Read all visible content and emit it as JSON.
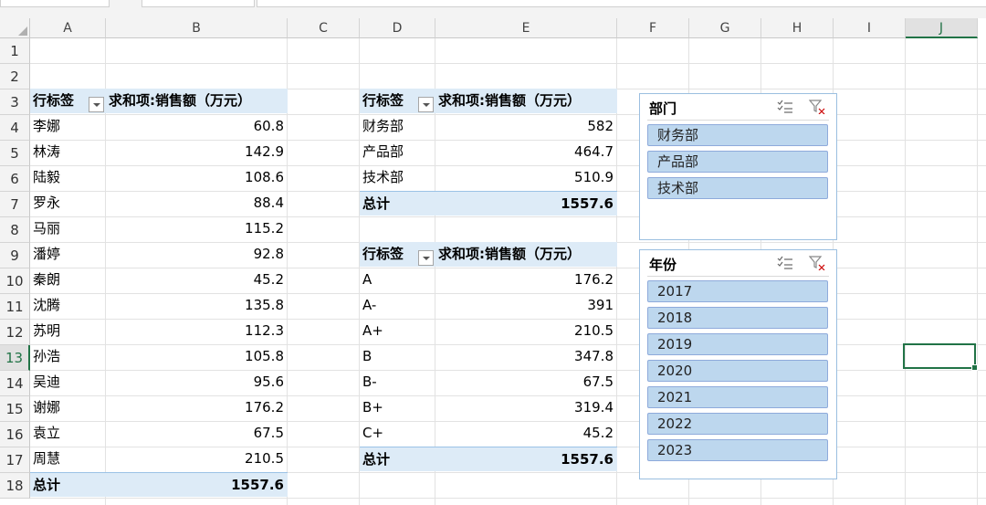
{
  "columns": [
    "A",
    "B",
    "C",
    "D",
    "E",
    "F",
    "G",
    "H",
    "I",
    "J"
  ],
  "selected_column": "J",
  "rows": [
    "1",
    "2",
    "3",
    "4",
    "5",
    "6",
    "7",
    "8",
    "9",
    "10",
    "11",
    "12",
    "13",
    "14",
    "15",
    "16",
    "17",
    "18"
  ],
  "selected_row": "13",
  "pivot1": {
    "row_label_header": "行标签",
    "value_header": "求和项:销售额（万元）",
    "rows": [
      {
        "label": "李娜",
        "value": "60.8"
      },
      {
        "label": "林涛",
        "value": "142.9"
      },
      {
        "label": "陆毅",
        "value": "108.6"
      },
      {
        "label": "罗永",
        "value": "88.4"
      },
      {
        "label": "马丽",
        "value": "115.2"
      },
      {
        "label": "潘婷",
        "value": "92.8"
      },
      {
        "label": "秦朗",
        "value": "45.2"
      },
      {
        "label": "沈腾",
        "value": "135.8"
      },
      {
        "label": "苏明",
        "value": "112.3"
      },
      {
        "label": "孙浩",
        "value": "105.8"
      },
      {
        "label": "吴迪",
        "value": "95.6"
      },
      {
        "label": "谢娜",
        "value": "176.2"
      },
      {
        "label": "袁立",
        "value": "67.5"
      },
      {
        "label": "周慧",
        "value": "210.5"
      }
    ],
    "total_label": "总计",
    "total_value": "1557.6"
  },
  "pivot2": {
    "row_label_header": "行标签",
    "value_header": "求和项:销售额（万元）",
    "rows": [
      {
        "label": "财务部",
        "value": "582"
      },
      {
        "label": "产品部",
        "value": "464.7"
      },
      {
        "label": "技术部",
        "value": "510.9"
      }
    ],
    "total_label": "总计",
    "total_value": "1557.6"
  },
  "pivot3": {
    "row_label_header": "行标签",
    "value_header": "求和项:销售额（万元）",
    "rows": [
      {
        "label": "A",
        "value": "176.2"
      },
      {
        "label": "A-",
        "value": "391"
      },
      {
        "label": "A+",
        "value": "210.5"
      },
      {
        "label": "B",
        "value": "347.8"
      },
      {
        "label": "B-",
        "value": "67.5"
      },
      {
        "label": "B+",
        "value": "319.4"
      },
      {
        "label": "C+",
        "value": "45.2"
      }
    ],
    "total_label": "总计",
    "total_value": "1557.6"
  },
  "slicer_dept": {
    "title": "部门",
    "items": [
      "财务部",
      "产品部",
      "技术部"
    ]
  },
  "slicer_year": {
    "title": "年份",
    "items": [
      "2017",
      "2018",
      "2019",
      "2020",
      "2021",
      "2022",
      "2023"
    ]
  },
  "icons": {
    "multiselect": "multi-select-icon",
    "clear_filter": "clear-filter-icon",
    "dropdown": "dropdown-arrow-icon"
  },
  "colors": {
    "pivot_header_bg": "#ddebf7",
    "slicer_item_bg": "#bdd7ee",
    "selection": "#217346"
  }
}
